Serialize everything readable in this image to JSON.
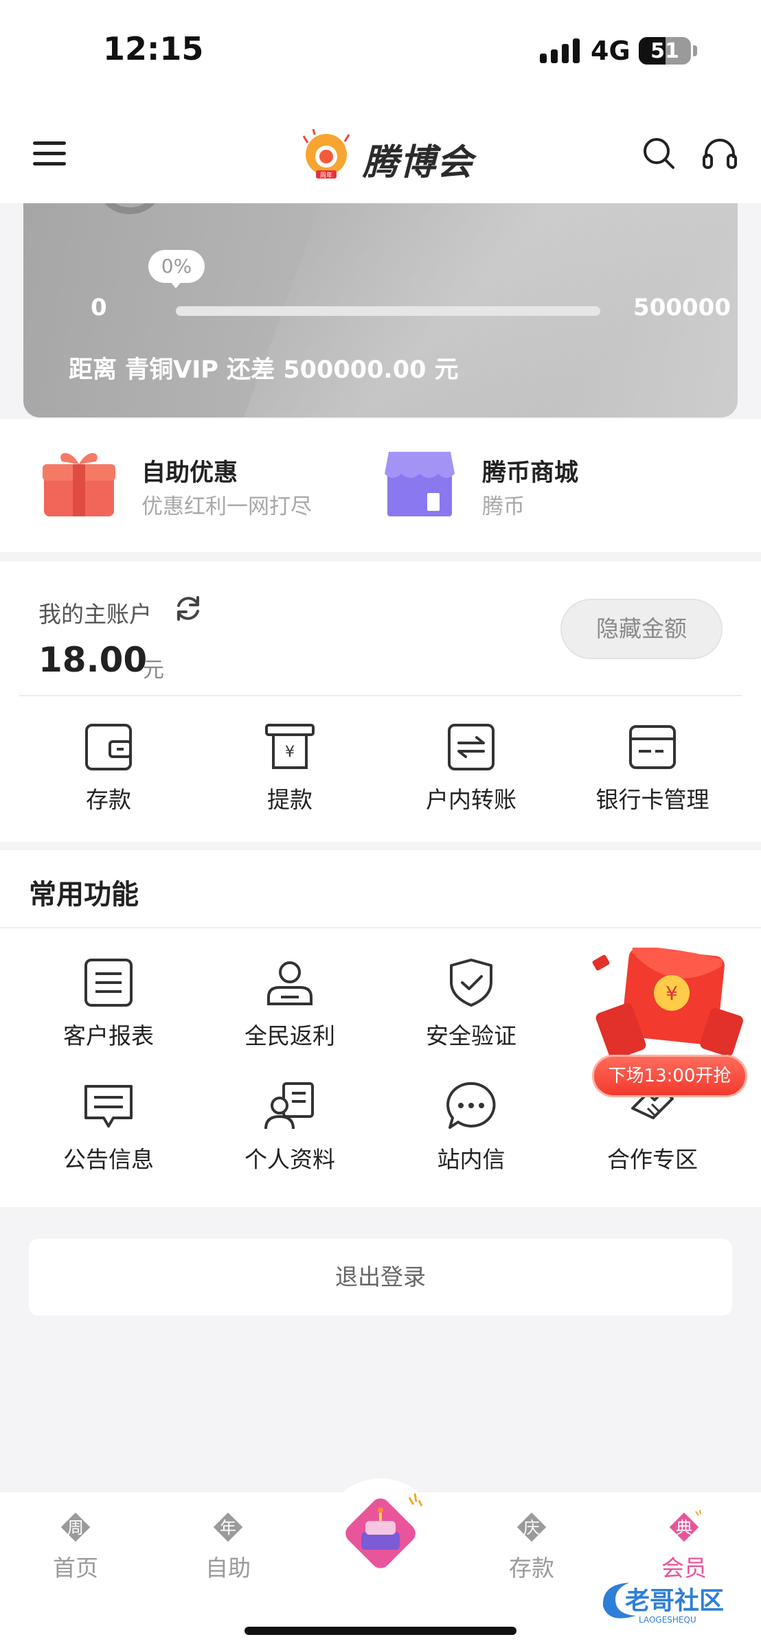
{
  "status_bar": {
    "time": "12:15",
    "network": "4G",
    "battery": "51",
    "battery_level": 0.51
  },
  "header": {
    "brand": "腾博会",
    "logo_badge": "周年"
  },
  "vip": {
    "progress_label": "0%",
    "progress_fraction": 0.0,
    "min": "0",
    "max": "500000",
    "gap_text": "距离 青铜VIP 还差 500000.00 元"
  },
  "promos": [
    {
      "title": "自助优惠",
      "subtitle": "优惠红利一网打尽",
      "icon": "gift-icon"
    },
    {
      "title": "腾币商城",
      "subtitle": "腾币",
      "icon": "store-icon"
    }
  ],
  "account": {
    "label": "我的主账户",
    "amount": "18.00",
    "unit": "元",
    "hide_button": "隐藏金额",
    "actions": [
      {
        "label": "存款",
        "icon": "wallet-icon"
      },
      {
        "label": "提款",
        "icon": "atm-withdraw-icon"
      },
      {
        "label": "户内转账",
        "icon": "transfer-icon"
      },
      {
        "label": "银行卡管理",
        "icon": "bank-card-icon"
      }
    ]
  },
  "common": {
    "title": "常用功能",
    "features": [
      {
        "label": "客户报表",
        "icon": "report-icon"
      },
      {
        "label": "全民返利",
        "icon": "user-rebate-icon"
      },
      {
        "label": "安全验证",
        "icon": "shield-check-icon"
      },
      {
        "label": "公告信息",
        "icon": "announcement-icon"
      },
      {
        "label": "个人资料",
        "icon": "profile-card-icon"
      },
      {
        "label": "站内信",
        "icon": "chat-bubble-icon"
      },
      {
        "label": "合作专区",
        "icon": "handshake-icon"
      }
    ]
  },
  "envelope": {
    "label": "下场13:00开抢",
    "coin": "¥"
  },
  "logout": "退出登录",
  "bottom_nav": [
    {
      "badge": "周",
      "label": "首页"
    },
    {
      "badge": "年",
      "label": "自助"
    },
    {
      "badge": "庆",
      "label": "存款"
    },
    {
      "badge": "典",
      "label": "会员"
    }
  ],
  "watermark": {
    "text": "老哥社区",
    "sub": "LAOGESHEQU"
  },
  "colors": {
    "accent_pink": "#e8559a",
    "envelope_red": "#f23a2e",
    "store_purple": "#8a78f0",
    "gift_red": "#f2665a"
  }
}
